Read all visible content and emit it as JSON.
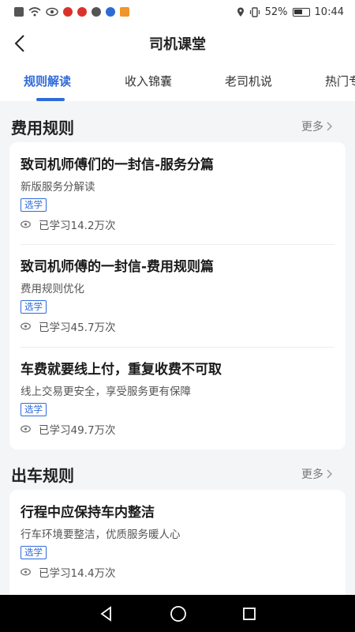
{
  "status_bar": {
    "battery": "52%",
    "time": "10:44"
  },
  "header": {
    "title": "司机课堂"
  },
  "tabs": [
    {
      "label": "规则解读",
      "active": true
    },
    {
      "label": "收入锦囊",
      "active": false
    },
    {
      "label": "老司机说",
      "active": false
    },
    {
      "label": "热门专",
      "active": false
    }
  ],
  "sections": [
    {
      "title": "费用规则",
      "more": "更多",
      "items": [
        {
          "title": "致司机师傅们的一封信-服务分篇",
          "subtitle": "新版服务分解读",
          "badge": "选学",
          "views": "已学习14.2万次"
        },
        {
          "title": "致司机师傅的一封信-费用规则篇",
          "subtitle": "费用规则优化",
          "badge": "选学",
          "views": "已学习45.7万次"
        },
        {
          "title": "车费就要线上付，重复收费不可取",
          "subtitle": "线上交易更安全，享受服务更有保障",
          "badge": "选学",
          "views": "已学习49.7万次"
        }
      ]
    },
    {
      "title": "出车规则",
      "more": "更多",
      "items": [
        {
          "title": "行程中应保持车内整洁",
          "subtitle": "行车环境要整洁，优质服务暖人心",
          "badge": "选学",
          "views": "已学习14.4万次"
        }
      ]
    }
  ],
  "colors": {
    "accent": "#2f6bd9",
    "background": "#f4f5f7"
  }
}
